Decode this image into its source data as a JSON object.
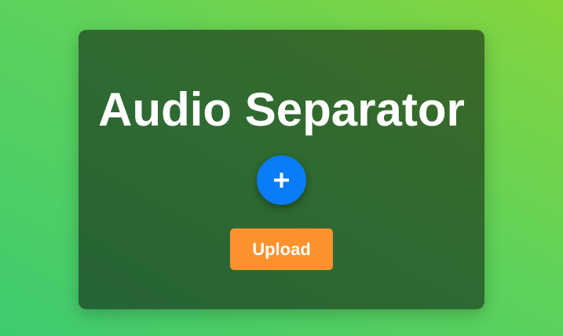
{
  "card": {
    "title": "Audio Separator"
  },
  "add_button": {
    "icon": "plus-icon",
    "color": "#0a7cf7"
  },
  "upload_button": {
    "label": "Upload",
    "color": "#fb922e"
  }
}
